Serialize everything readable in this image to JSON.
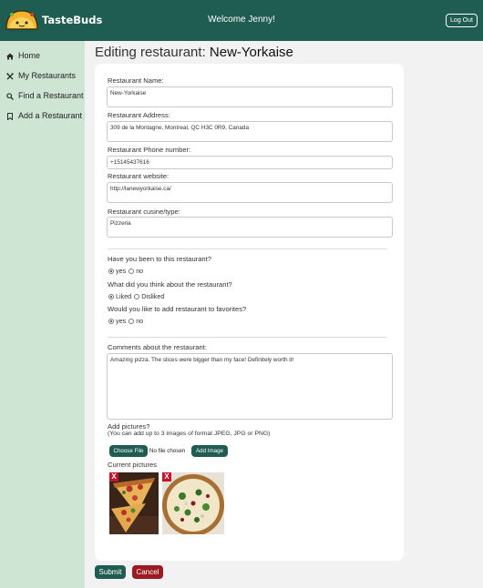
{
  "header": {
    "brand": "TasteBuds",
    "welcome": "Welcome Jenny!",
    "logout_label": "Log Out",
    "color": "#1f5c52"
  },
  "sidebar": {
    "color": "#cde5d2",
    "items": [
      {
        "label": "Home",
        "icon": "home-icon"
      },
      {
        "label": "My Restaurants",
        "icon": "utensils-icon"
      },
      {
        "label": "Find a Restaurant",
        "icon": "search-icon"
      },
      {
        "label": "Add a Restaurant",
        "icon": "bookmark-icon"
      }
    ]
  },
  "page": {
    "title_prefix": "Editing restaurant: ",
    "title_name": "New-Yorkaise"
  },
  "form": {
    "name_label": "Restaurant Name:",
    "name_value": "New-Yorkaise",
    "address_label": "Restaurant Address:",
    "address_value": "309 de la Montagne, Montreal, QC H3C 0R9, Canada",
    "phone_label": "Restaurant Phone number:",
    "phone_value": "+15145437616",
    "website_label": "Restaurant website:",
    "website_value": "http://lanewyorkaise.ca/",
    "cuisine_label": "Restaurant cusine/type:",
    "cuisine_value": "Pizzeria",
    "visited_question": "Have you been to this restaurant?",
    "visited_options": [
      "yes",
      "no"
    ],
    "visited_selected": "yes",
    "opinion_question": "What did you think about the restaurant?",
    "opinion_options": [
      "Liked",
      "Disliked"
    ],
    "opinion_selected": "Liked",
    "favorite_question": "Would you like to add restaurant to favorites?",
    "favorite_options": [
      "yes",
      "no"
    ],
    "favorite_selected": "yes",
    "comments_label": "Comments about the restaurant:",
    "comments_value": "Amazing pizza. The slices were bigger than my face! Definitely worth it!",
    "pictures_label": "Add pictures?",
    "pictures_hint": "(You can add up to 3 images of format JPEG, JPG or PNG)",
    "choose_file_label": "Choose File",
    "no_file_text": "No file chosen",
    "add_image_label": "Add Image",
    "current_pictures_label": "Current pictures",
    "delete_label": "X"
  },
  "actions": {
    "submit_label": "Submit",
    "cancel_label": "Cancel",
    "cancel_color": "#9c1a22"
  }
}
